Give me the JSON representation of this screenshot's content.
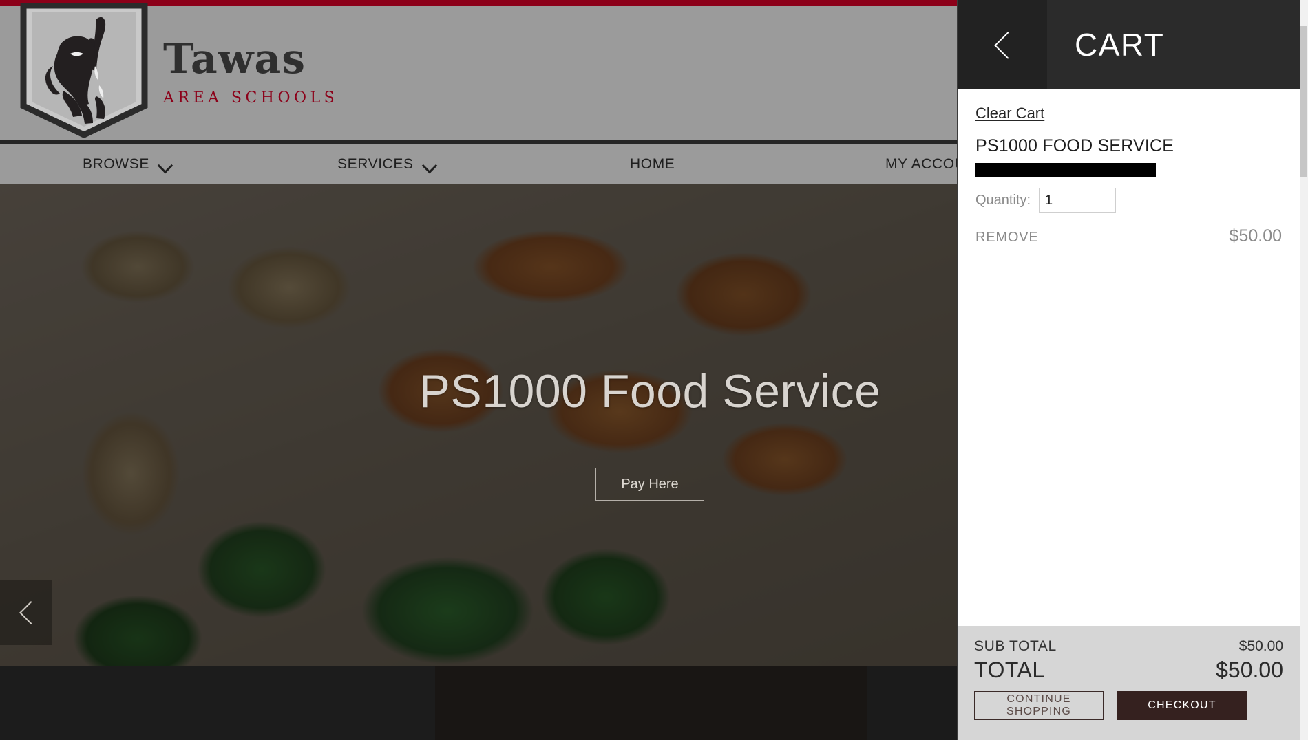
{
  "brand": {
    "name": "Tawas",
    "subtitle": "AREA SCHOOLS",
    "logo_icon": "school-shield-logo",
    "accent_color": "#8c0019",
    "header_color": "#9b9b9b"
  },
  "nav": {
    "items": [
      {
        "label": "BROWSE",
        "has_dropdown": true,
        "icon": "chevron-down-icon"
      },
      {
        "label": "SERVICES",
        "has_dropdown": true,
        "icon": "chevron-down-icon"
      },
      {
        "label": "HOME",
        "has_dropdown": false,
        "icon": ""
      },
      {
        "label": "MY ACCOUNT",
        "has_dropdown": false,
        "icon": ""
      }
    ]
  },
  "hero": {
    "title": "PS1000 Food Service",
    "button_label": "Pay Here",
    "prev_icon": "chevron-left-icon"
  },
  "cart": {
    "title": "CART",
    "back_icon": "chevron-left-icon",
    "clear_label": "Clear Cart",
    "items": [
      {
        "name": "PS1000 FOOD SERVICE",
        "redacted": true,
        "quantity_label": "Quantity:",
        "quantity": "1",
        "remove_label": "REMOVE",
        "price": "$50.00"
      }
    ],
    "summary": {
      "sub_total_label": "SUB TOTAL",
      "sub_total_value": "$50.00",
      "total_label": "TOTAL",
      "total_value": "$50.00"
    },
    "actions": {
      "continue_label": "CONTINUE SHOPPING",
      "checkout_label": "CHECKOUT",
      "checkout_color": "#35211f"
    }
  }
}
